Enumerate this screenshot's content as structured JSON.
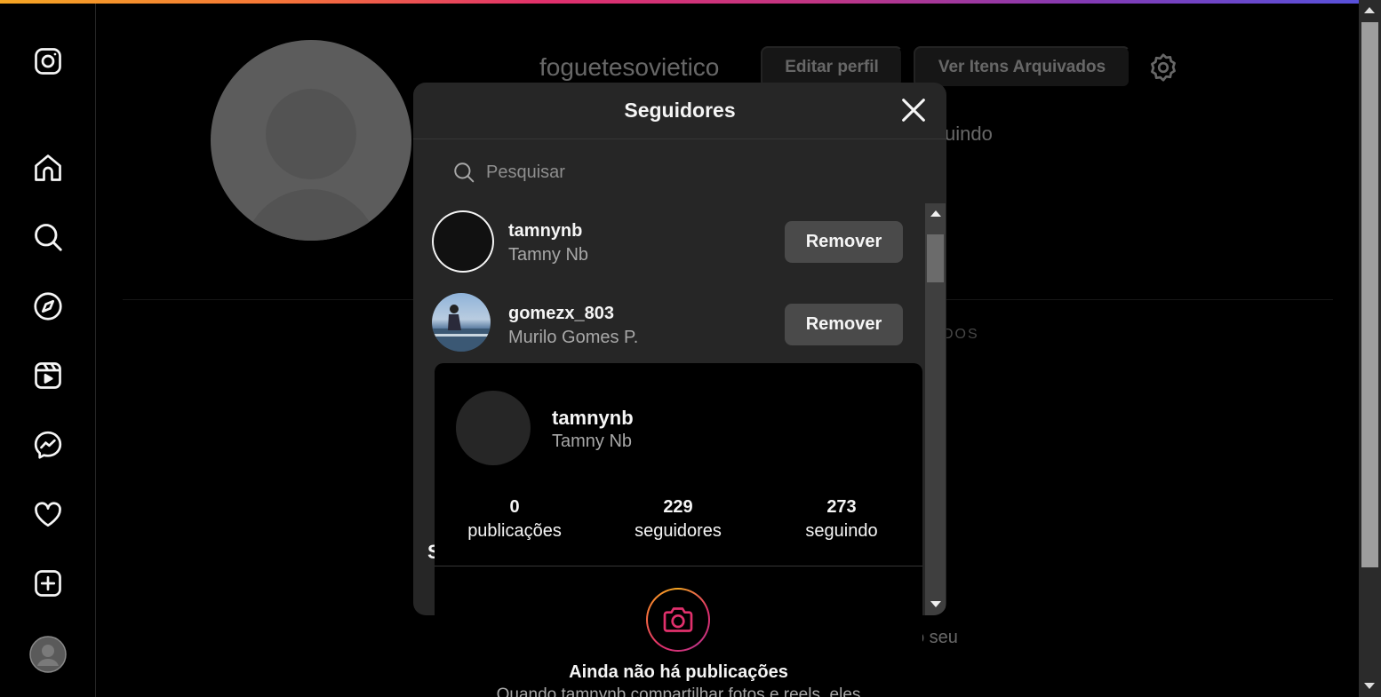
{
  "profile": {
    "username": "foguetesovietico",
    "edit_label": "Editar perfil",
    "archive_label": "Ver Itens Arquivados",
    "following_fragment": "uindo",
    "tab_fragment": "DOS",
    "text_fragment": "o seu"
  },
  "nav": {
    "items": [
      "instagram-logo",
      "home",
      "search",
      "explore",
      "reels",
      "messages",
      "notifications",
      "create",
      "profile"
    ]
  },
  "modal": {
    "title": "Seguidores",
    "search_placeholder": "Pesquisar",
    "followers": [
      {
        "username": "tamnynb",
        "full_name": "Tamny Nb",
        "action": "Remover"
      },
      {
        "username": "gomezx_803",
        "full_name": "Murilo Gomes P.",
        "action": "Remover"
      }
    ],
    "fragment": "S"
  },
  "hover_card": {
    "username": "tamnynb",
    "full_name": "Tamny Nb",
    "stats": [
      {
        "number": "0",
        "label": "publicações"
      },
      {
        "number": "229",
        "label": "seguidores"
      },
      {
        "number": "273",
        "label": "seguindo"
      }
    ],
    "empty_title": "Ainda não há publicações",
    "empty_desc": "Quando tamnynb compartilhar fotos e reels, eles"
  }
}
